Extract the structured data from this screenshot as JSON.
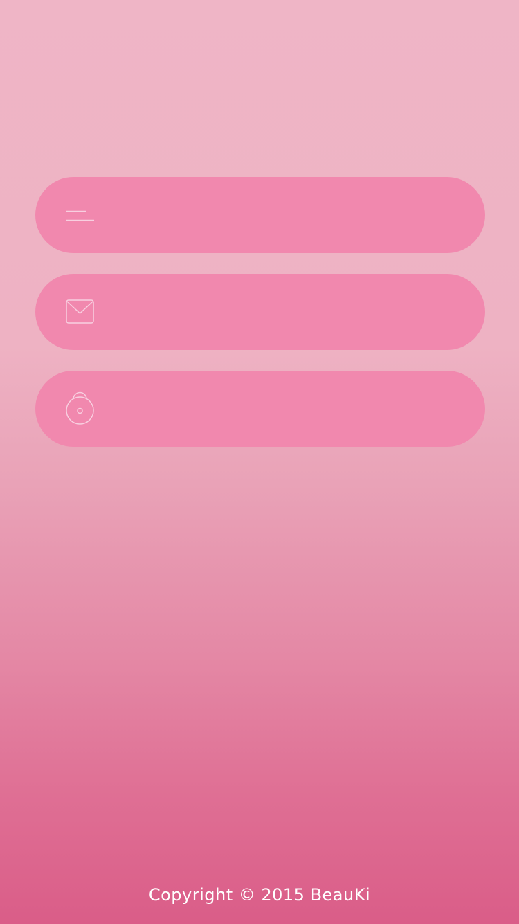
{
  "form": {
    "username": {
      "icon": "name-lines-icon",
      "value": "",
      "placeholder": ""
    },
    "email": {
      "icon": "envelope-icon",
      "value": "",
      "placeholder": ""
    },
    "password": {
      "icon": "lock-icon",
      "value": "",
      "placeholder": ""
    }
  },
  "footer": {
    "copyright": "Copyright © 2015 BeauKi"
  },
  "colors": {
    "background_top": "#efb5c6",
    "background_bottom": "#da5d88",
    "field_fill": "#f188ae",
    "icon_stroke": "#f8cfe0",
    "text": "#ffffff"
  }
}
